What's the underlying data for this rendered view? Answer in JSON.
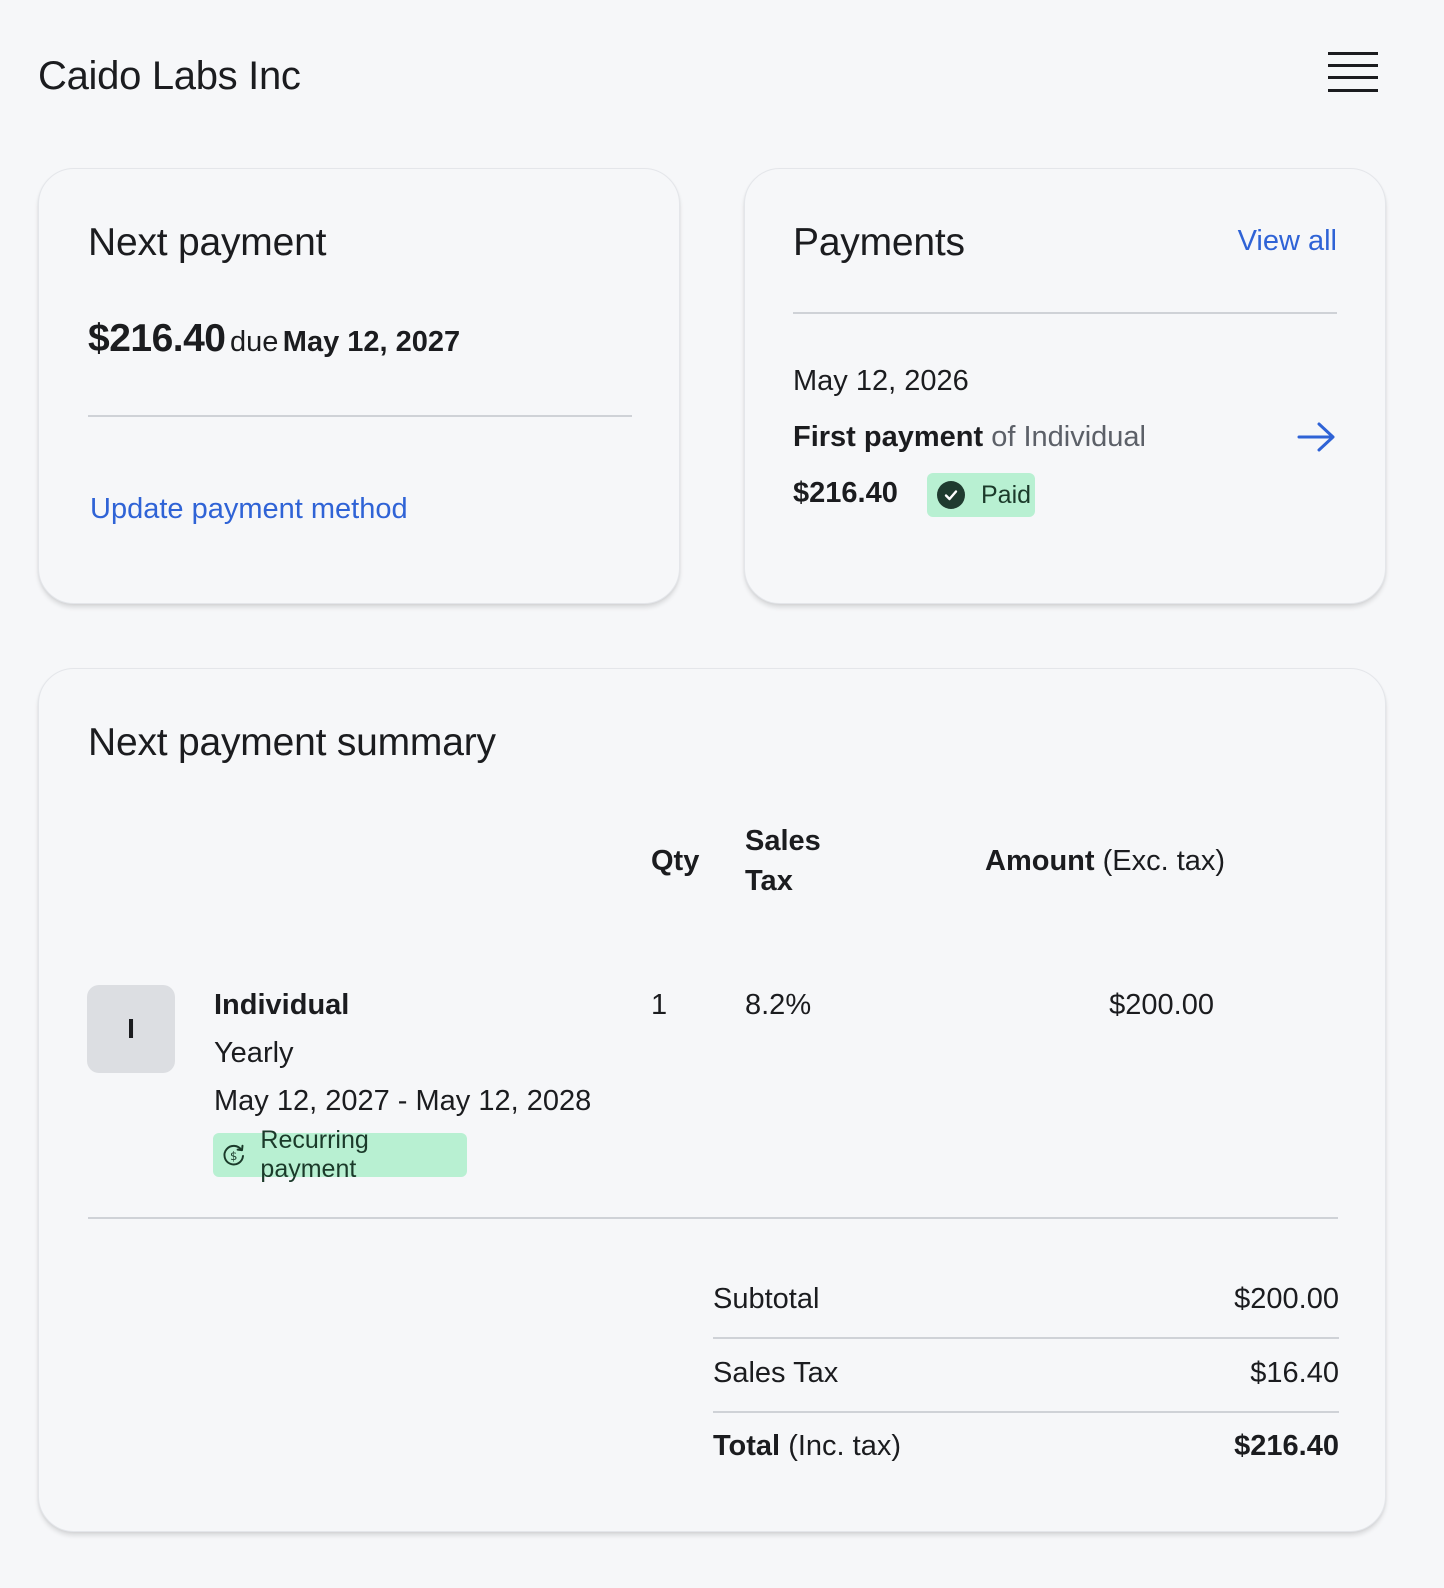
{
  "header": {
    "company_name": "Caido Labs Inc",
    "menu_icon": "hamburger-menu-icon"
  },
  "next_payment": {
    "title": "Next payment",
    "amount": "$216.40",
    "due_label": "due",
    "due_date": "May 12, 2027",
    "update_link": "Update payment method"
  },
  "payments": {
    "title": "Payments",
    "view_all": "View all",
    "item": {
      "date": "May 12, 2026",
      "label_bold": "First payment",
      "label_rest": "of Individual",
      "amount": "$216.40",
      "status": "Paid",
      "status_color": "#b8f0d2"
    }
  },
  "summary": {
    "title": "Next payment summary",
    "columns": {
      "qty": "Qty",
      "sales_tax_line1": "Sales",
      "sales_tax_line2": "Tax",
      "amount_bold": "Amount",
      "amount_rest": "(Exc. tax)"
    },
    "item": {
      "avatar_letter": "I",
      "name": "Individual",
      "interval": "Yearly",
      "period": "May 12, 2027 - May 12, 2028",
      "badge": "Recurring payment",
      "qty": "1",
      "tax_rate": "8.2%",
      "amount": "$200.00"
    },
    "totals": {
      "subtotal_label": "Subtotal",
      "subtotal_value": "$200.00",
      "tax_label": "Sales Tax",
      "tax_value": "$16.40",
      "total_label_bold": "Total",
      "total_label_rest": "(Inc. tax)",
      "total_value": "$216.40"
    }
  },
  "colors": {
    "link": "#2f63d6",
    "badge_green": "#b8f0d2",
    "background": "#f6f7f9"
  }
}
